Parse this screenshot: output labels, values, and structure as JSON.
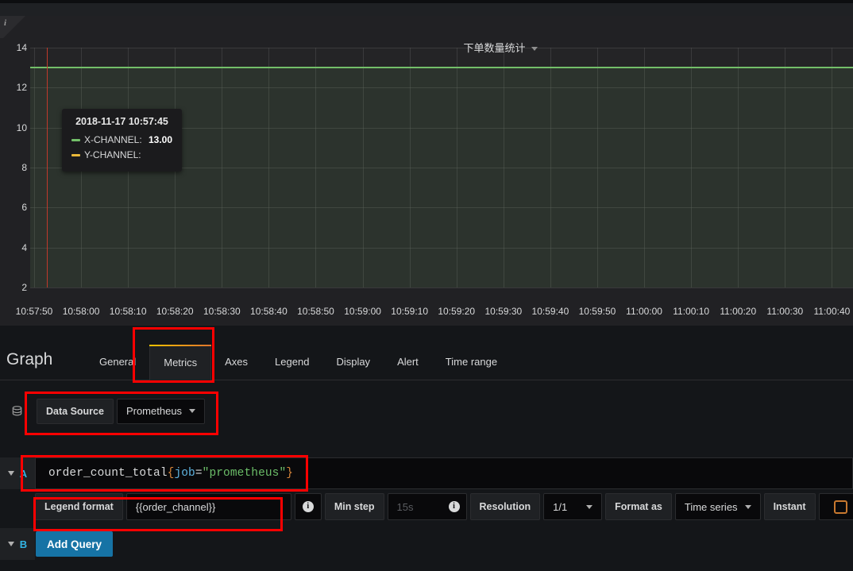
{
  "panel": {
    "title": "下单数量统计",
    "corner_info_icon": "info-icon",
    "y_ticks": [
      "14",
      "12",
      "10",
      "8",
      "6",
      "4",
      "2"
    ],
    "x_ticks": [
      "10:57:50",
      "10:58:00",
      "10:58:10",
      "10:58:20",
      "10:58:30",
      "10:58:40",
      "10:58:50",
      "10:59:00",
      "10:59:10",
      "10:59:20",
      "10:59:30",
      "10:59:40",
      "10:59:50",
      "11:00:00",
      "11:00:10",
      "11:00:20",
      "11:00:30",
      "11:00:40"
    ],
    "legend": [
      {
        "label": "X-CHANNEL",
        "color": "#73bf69"
      },
      {
        "label": "Y-CHANNEL",
        "color": "#eab839"
      }
    ]
  },
  "tooltip": {
    "time": "2018-11-17 10:57:45",
    "rows": [
      {
        "label": "X-CHANNEL:",
        "value": "13.00",
        "color": "#73bf69"
      },
      {
        "label": "Y-CHANNEL:",
        "value": "",
        "color": "#eab839"
      }
    ]
  },
  "chart_data": {
    "type": "line",
    "title": "下单数量统计",
    "xlabel": "",
    "ylabel": "",
    "ylim": [
      2,
      14
    ],
    "grid": true,
    "legend_position": "bottom-left",
    "x": [
      "10:57:50",
      "10:58:00",
      "10:58:10",
      "10:58:20",
      "10:58:30",
      "10:58:40",
      "10:58:50",
      "10:59:00",
      "10:59:10",
      "10:59:20",
      "10:59:30",
      "10:59:40",
      "10:59:50",
      "11:00:00",
      "11:00:10",
      "11:00:20",
      "11:00:30",
      "11:00:40"
    ],
    "series": [
      {
        "name": "X-CHANNEL",
        "color": "#73bf69",
        "values": [
          13,
          13,
          13,
          13,
          13,
          13,
          13,
          13,
          13,
          13,
          13,
          13,
          13,
          13,
          13,
          13,
          13,
          13
        ]
      },
      {
        "name": "Y-CHANNEL",
        "color": "#eab839",
        "values": []
      }
    ],
    "annotations": [
      {
        "type": "crosshair",
        "x": "10:57:45",
        "color": "#c0392b"
      }
    ],
    "hover": {
      "x": "2018-11-17 10:57:45",
      "X-CHANNEL": 13.0,
      "Y-CHANNEL": null
    }
  },
  "editor": {
    "heading": "Graph",
    "tabs": [
      {
        "label": "General",
        "active": false
      },
      {
        "label": "Metrics",
        "active": true
      },
      {
        "label": "Axes",
        "active": false
      },
      {
        "label": "Legend",
        "active": false
      },
      {
        "label": "Display",
        "active": false
      },
      {
        "label": "Alert",
        "active": false
      },
      {
        "label": "Time range",
        "active": false
      }
    ],
    "datasource": {
      "icon": "database-icon",
      "label": "Data Source",
      "value": "Prometheus"
    },
    "queries": [
      {
        "ref": "A",
        "expr_name": "order_count_total",
        "expr_label": "job",
        "expr_value": "\"prometheus\""
      },
      {
        "ref": "B"
      }
    ],
    "options": {
      "legend_format_label": "Legend format",
      "legend_format_value": "{{order_channel}}",
      "legend_format_info_icon": "info-icon",
      "min_step_label": "Min step",
      "min_step_placeholder": "15s",
      "min_step_info_icon": "info-icon",
      "resolution_label": "Resolution",
      "resolution_value": "1/1",
      "format_as_label": "Format as",
      "format_as_value": "Time series",
      "instant_label": "Instant",
      "instant_checked": false
    },
    "add_query_label": "Add Query"
  },
  "colors": {
    "annotation": "#ff0000",
    "accent_tab": "#e0752d",
    "primary_button": "#1673a5",
    "checkbox_border": "#c7782f"
  }
}
